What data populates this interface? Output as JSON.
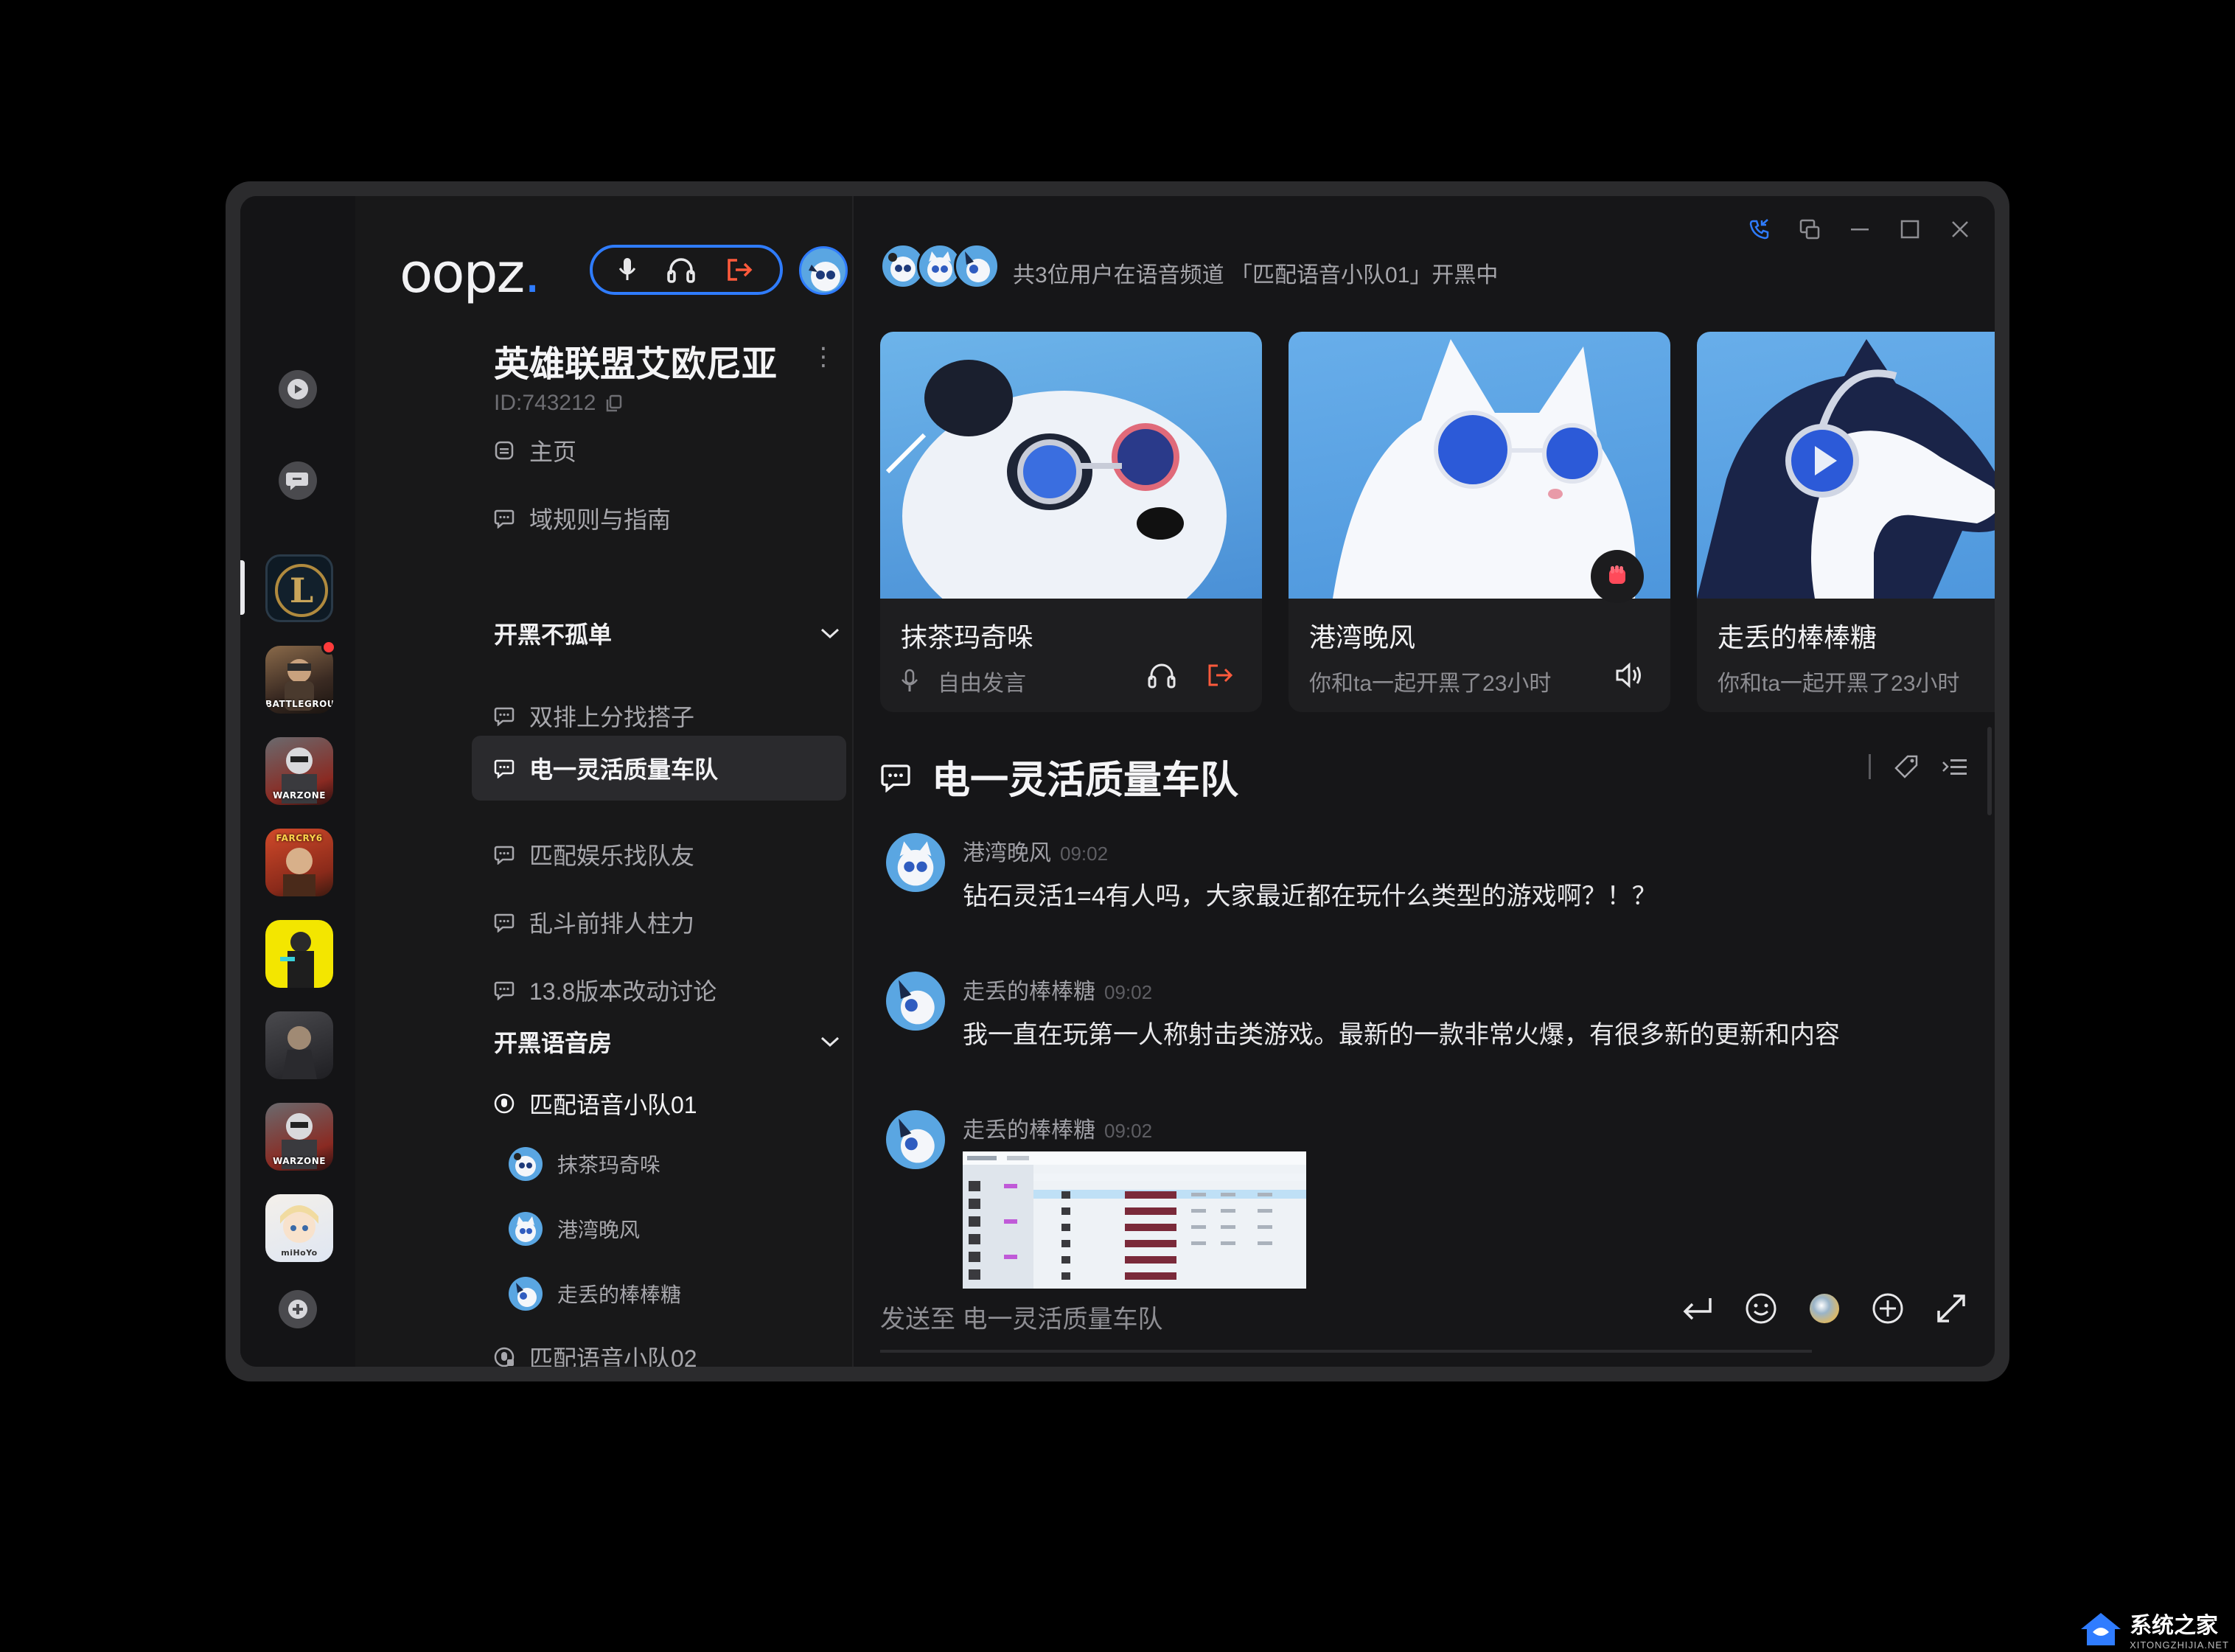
{
  "app": {
    "logo_text": "oopz",
    "logo_dot": "."
  },
  "rail": {
    "games": [
      {
        "name": "league-of-legends",
        "label": "L"
      },
      {
        "name": "pubg",
        "label": "BATTLEGROUNDS"
      },
      {
        "name": "warzone",
        "label": "WARZONE"
      },
      {
        "name": "farcry",
        "label": "FARCRY6"
      },
      {
        "name": "cyberpunk",
        "label": ""
      },
      {
        "name": "death-stranding",
        "label": ""
      },
      {
        "name": "warzone-2",
        "label": "WARZONE"
      },
      {
        "name": "genshin",
        "label": "miHoYo"
      }
    ]
  },
  "server": {
    "title": "英雄联盟艾欧尼亚",
    "id": "ID:743212"
  },
  "channels": {
    "home": "主页",
    "rules": "域规则与指南",
    "cat1": "开黑不孤单",
    "c1": "双排上分找搭子",
    "c2": "电一灵活质量车队",
    "c3": "匹配娱乐找队友",
    "c4": "乱斗前排人柱力",
    "c5": "13.8版本改动讨论",
    "cat2": "开黑语音房",
    "voice1": "匹配语音小队01",
    "voice_users": [
      "抹茶玛奇哚",
      "港湾晚风",
      "走丢的棒棒糖"
    ],
    "voice2": "匹配语音小队02"
  },
  "topbar": {
    "status": "共3位用户在语音频道 「匹配语音小队01」开黑中"
  },
  "cards": [
    {
      "name": "抹茶玛奇哚",
      "status": "自由发言"
    },
    {
      "name": "港湾晚风",
      "status": "你和ta一起开黑了23小时"
    },
    {
      "name": "走丢的棒棒糖",
      "status": "你和ta一起开黑了23小时"
    }
  ],
  "chat": {
    "channel_title": "电一灵活质量车队",
    "messages": [
      {
        "user": "港湾晚风",
        "time": "09:02",
        "text": "钻石灵活1=4有人吗，大家最近都在玩什么类型的游戏啊？！？"
      },
      {
        "user": "走丢的棒棒糖",
        "time": "09:02",
        "text": "我一直在玩第一人称射击类游戏。最新的一款非常火爆，有很多新的更新和内容"
      },
      {
        "user": "走丢的棒棒糖",
        "time": "09:02",
        "text": ""
      }
    ],
    "composer_placeholder": "发送至 电一灵活质量车队"
  },
  "colors": {
    "accent": "#2f7cff",
    "danger": "#ff5a3c",
    "bg": "#161618"
  },
  "watermark": {
    "main": "系统之家",
    "sub": "XITONGZHIJIA.NET"
  }
}
